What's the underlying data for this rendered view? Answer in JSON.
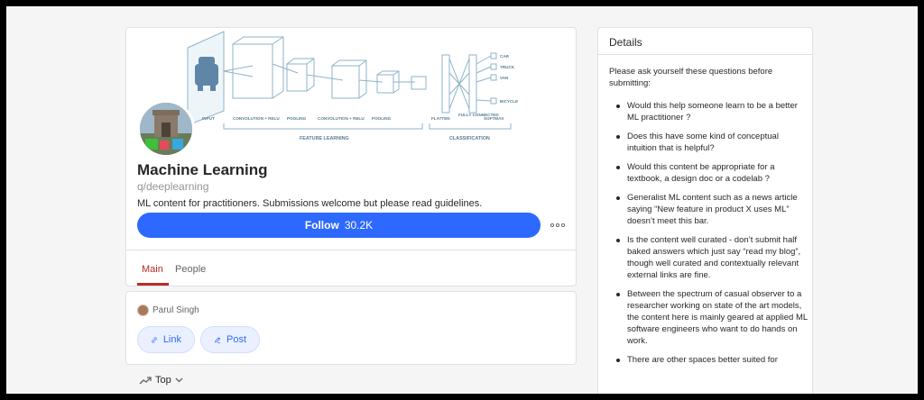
{
  "space": {
    "title": "Machine Learning",
    "handle": "q/deeplearning",
    "description": "ML content for practitioners. Submissions welcome but please read guidelines.",
    "follow_label": "Follow",
    "follow_count": "30.2K",
    "more_label": "•••"
  },
  "banner": {
    "labels": {
      "input": "INPUT",
      "conv1": "CONVOLUTION + RELU",
      "pool1": "POOLING",
      "conv2": "CONVOLUTION + RELU",
      "pool2": "POOLING",
      "flatten": "FLATTEN",
      "fully_connected": "FULLY CONNECTED",
      "softmax": "SOFTMAX",
      "feature_learning": "FEATURE LEARNING",
      "classification": "CLASSIFICATION",
      "car": "CAR",
      "truck": "TRUCK",
      "van": "VAN",
      "bicycle": "BICYCLE"
    }
  },
  "tabs": [
    {
      "label": "Main",
      "active": true
    },
    {
      "label": "People",
      "active": false
    }
  ],
  "composer": {
    "user_name": "Parul Singh",
    "link_label": "Link",
    "post_label": "Post"
  },
  "sort": {
    "label": "Top"
  },
  "details": {
    "heading": "Details",
    "intro": "Please ask yourself these questions before submitting:",
    "rules": [
      "Would this help someone learn to be a better ML practitioner ?",
      "Does this have some kind of conceptual intuition that is helpful?",
      "Would this content be appropriate for a textbook, a design doc or a codelab ?",
      "Generalist ML content such as a news article saying “New feature in product X uses ML” doesn’t meet this bar.",
      "Is the content well curated - don’t submit half baked answers which just say “read my blog”, though well curated and contextually relevant external links are fine.",
      "Between the spectrum of casual observer to a researcher working on state of the art models, the content here is mainly geared at applied ML software engineers who want to do hands on work.",
      "There are other spaces better suited for"
    ]
  },
  "colors": {
    "accent": "#2e69ff",
    "tab_active": "#b92b27",
    "page_bg": "#f5f5f5",
    "border": "#dee0e1"
  },
  "icons": {
    "more": "more-dots-icon",
    "link": "link-icon",
    "post": "pencil-icon",
    "sort": "trending-up-icon",
    "sort_chevron": "chevron-down-icon"
  }
}
